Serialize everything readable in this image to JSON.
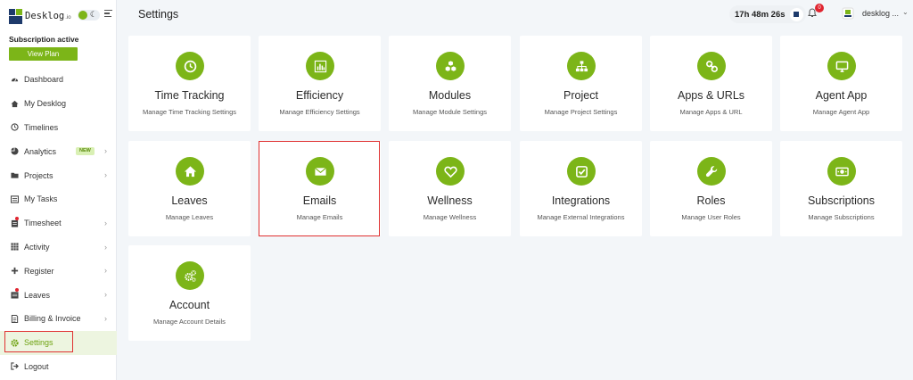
{
  "brand": {
    "name": "Desklog",
    "suffix": ".io"
  },
  "subscription": {
    "status": "Subscription active",
    "button": "View Plan"
  },
  "nav": [
    {
      "label": "Dashboard",
      "icon": "dashboard-icon"
    },
    {
      "label": "My Desklog",
      "icon": "home-icon"
    },
    {
      "label": "Timelines",
      "icon": "clock-icon"
    },
    {
      "label": "Analytics",
      "icon": "pie-chart-icon",
      "badge": "NEW",
      "chevron": true
    },
    {
      "label": "Projects",
      "icon": "folder-icon",
      "chevron": true
    },
    {
      "label": "My Tasks",
      "icon": "tasks-icon"
    },
    {
      "label": "Timesheet",
      "icon": "timesheet-icon",
      "chevron": true,
      "dot": true
    },
    {
      "label": "Activity",
      "icon": "grid-icon",
      "chevron": true
    },
    {
      "label": "Register",
      "icon": "plus-icon",
      "chevron": true
    },
    {
      "label": "Leaves",
      "icon": "calendar-icon",
      "chevron": true,
      "dot": true
    },
    {
      "label": "Billing & Invoice",
      "icon": "invoice-icon",
      "chevron": true
    },
    {
      "label": "Settings",
      "icon": "gear-icon",
      "active": true
    },
    {
      "label": "Logout",
      "icon": "logout-icon"
    }
  ],
  "header": {
    "title": "Settings",
    "timer": "17h 48m 26s",
    "notifications": "0",
    "user": "desklog ..."
  },
  "cards": [
    {
      "title": "Time Tracking",
      "subtitle": "Manage Time Tracking Settings",
      "icon": "clock-icon"
    },
    {
      "title": "Efficiency",
      "subtitle": "Manage Efficiency Settings",
      "icon": "bar-chart-icon"
    },
    {
      "title": "Modules",
      "subtitle": "Manage Module Settings",
      "icon": "cubes-icon"
    },
    {
      "title": "Project",
      "subtitle": "Manage Project Settings",
      "icon": "sitemap-icon"
    },
    {
      "title": "Apps & URLs",
      "subtitle": "Manage Apps & URL",
      "icon": "link-icon"
    },
    {
      "title": "Agent App",
      "subtitle": "Manage Agent App",
      "icon": "monitor-icon"
    },
    {
      "title": "Leaves",
      "subtitle": "Manage Leaves",
      "icon": "home-icon"
    },
    {
      "title": "Emails",
      "subtitle": "Manage Emails",
      "icon": "envelope-icon"
    },
    {
      "title": "Wellness",
      "subtitle": "Manage Wellness",
      "icon": "heart-icon"
    },
    {
      "title": "Integrations",
      "subtitle": "Manage External Integrations",
      "icon": "check-square-icon"
    },
    {
      "title": "Roles",
      "subtitle": "Manage User Roles",
      "icon": "wrench-icon"
    },
    {
      "title": "Subscriptions",
      "subtitle": "Manage Subscriptions",
      "icon": "money-icon"
    },
    {
      "title": "Account",
      "subtitle": "Manage Account Details",
      "icon": "gears-icon"
    }
  ],
  "colors": {
    "accent": "#7cb518",
    "highlight": "#e03131",
    "background": "#f3f6f9"
  }
}
